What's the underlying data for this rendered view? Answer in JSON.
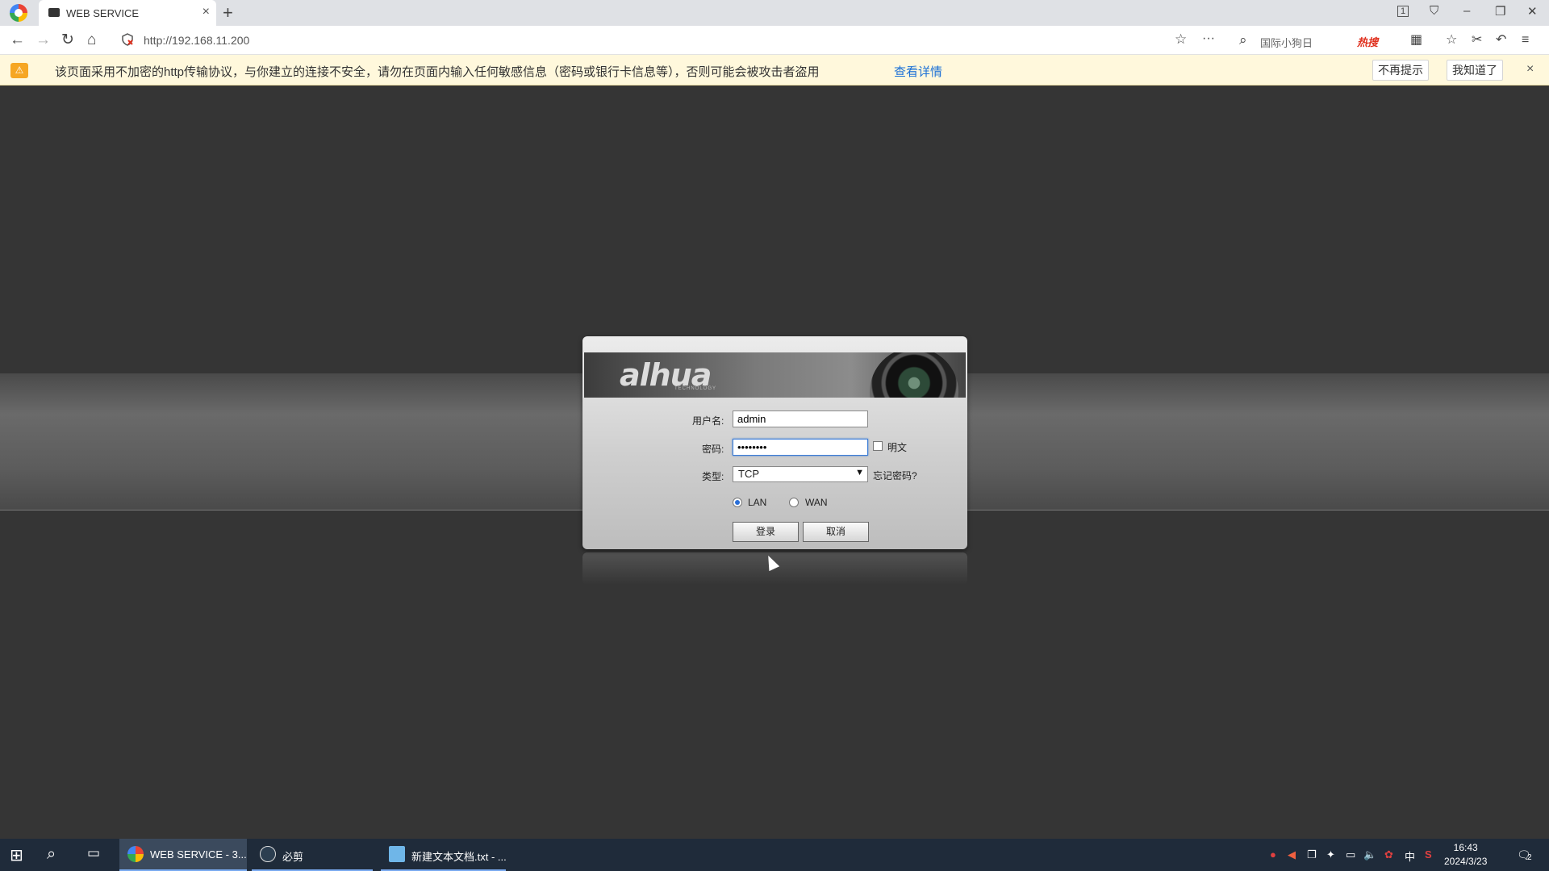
{
  "browser": {
    "tab_title": "WEB SERVICE",
    "tab_close": "×",
    "new_tab": "+",
    "url": "http://192.168.11.200",
    "search_placeholder": "国际小狗日",
    "hot_label": "热搜",
    "window_controls": [
      "1",
      "⛉",
      "–",
      "❐",
      "✕"
    ]
  },
  "infobar": {
    "message": "该页面采用不加密的http传输协议，与你建立的连接不安全，请勿在页面内输入任何敏感信息（密码或银行卡信息等），否则可能会被攻击者盗用",
    "link": "查看详情",
    "dismiss_forever": "不再提示",
    "acknowledge": "我知道了",
    "close": "×"
  },
  "login": {
    "brand": "alhua",
    "brand_sub": "TECHNOLOGY",
    "username_label": "用户名:",
    "username_value": "admin",
    "password_label": "密码:",
    "password_value": "••••••••",
    "show_plain_label": "明文",
    "type_label": "类型:",
    "type_selected": "TCP",
    "forgot_password": "忘记密码?",
    "network_options": [
      "LAN",
      "WAN"
    ],
    "network_selected": "LAN",
    "login_button": "登录",
    "cancel_button": "取消"
  },
  "taskbar": {
    "tasks": [
      {
        "label": "WEB SERVICE - 3..."
      },
      {
        "label": "必剪"
      },
      {
        "label": "新建文本文档.txt - ..."
      }
    ],
    "tray": {
      "ime": "中",
      "time": "16:43",
      "date": "2024/3/23",
      "notifications": "2"
    }
  },
  "colors": {
    "page_bg": "#353535",
    "accent_blue": "#1a6fd6",
    "taskbar": "#1f2b3a",
    "infobar": "#fff8dc"
  }
}
